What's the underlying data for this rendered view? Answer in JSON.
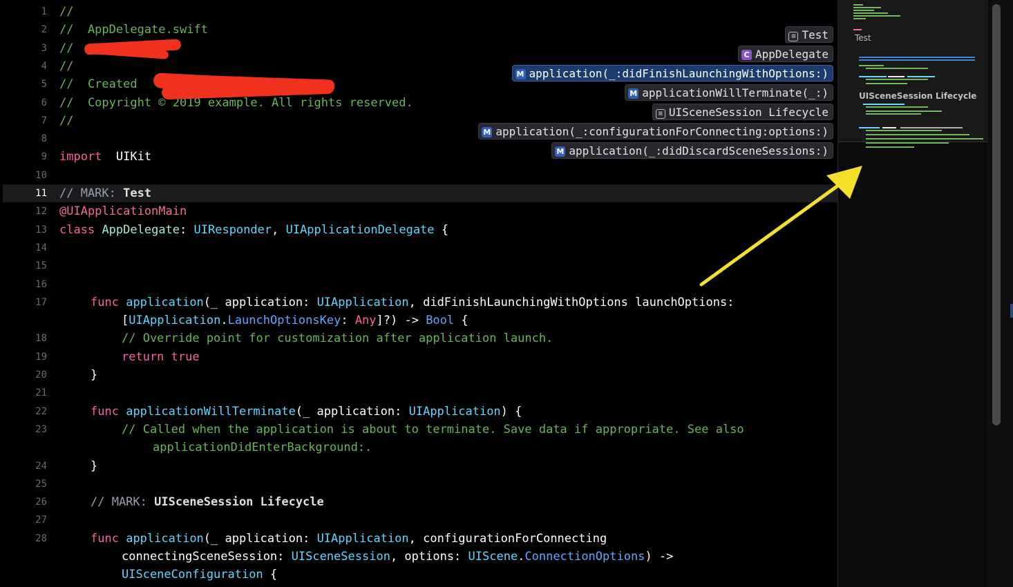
{
  "editor": {
    "lines": [
      {
        "n": "1",
        "ind": 0,
        "tokens": [
          [
            "cm",
            "//"
          ]
        ]
      },
      {
        "n": "2",
        "ind": 0,
        "tokens": [
          [
            "cm",
            "//  AppDelegate.swift"
          ]
        ]
      },
      {
        "n": "3",
        "ind": 0,
        "tokens": [
          [
            "cm",
            "//  "
          ]
        ]
      },
      {
        "n": "4",
        "ind": 0,
        "tokens": [
          [
            "cm",
            "//"
          ]
        ]
      },
      {
        "n": "5",
        "ind": 0,
        "tokens": [
          [
            "cm",
            "//  Created "
          ]
        ]
      },
      {
        "n": "6",
        "ind": 0,
        "tokens": [
          [
            "cm",
            "//  Copyright © 2019 example. All rights reserved."
          ]
        ]
      },
      {
        "n": "7",
        "ind": 0,
        "tokens": [
          [
            "cm",
            "//"
          ]
        ]
      },
      {
        "n": "8",
        "ind": 0,
        "tokens": []
      },
      {
        "n": "9",
        "ind": 0,
        "tokens": [
          [
            "kw",
            "import"
          ],
          [
            "",
            "  UIKit"
          ]
        ]
      },
      {
        "n": "10",
        "ind": 0,
        "tokens": []
      },
      {
        "n": "11",
        "ind": 0,
        "current": true,
        "tokens": [
          [
            "mark",
            "// MARK: "
          ],
          [
            "markb",
            "Test"
          ]
        ]
      },
      {
        "n": "12",
        "ind": 0,
        "tokens": [
          [
            "attr",
            "@UIApplicationMain"
          ]
        ]
      },
      {
        "n": "13",
        "ind": 0,
        "tokens": [
          [
            "kw",
            "class"
          ],
          [
            "",
            " "
          ],
          [
            "cls",
            "AppDelegate"
          ],
          [
            "",
            ": "
          ],
          [
            "ty",
            "UIResponder"
          ],
          [
            "",
            ", "
          ],
          [
            "ty",
            "UIApplicationDelegate"
          ],
          [
            "",
            " {"
          ]
        ]
      },
      {
        "n": "14",
        "ind": 0,
        "tokens": []
      },
      {
        "n": "15",
        "ind": 0,
        "tokens": []
      },
      {
        "n": "16",
        "ind": 0,
        "tokens": []
      },
      {
        "n": "17",
        "ind": 2,
        "tokens": [
          [
            "kw",
            "func"
          ],
          [
            "",
            " "
          ],
          [
            "ty",
            "application"
          ],
          [
            "",
            "(_ application: "
          ],
          [
            "ty",
            "UIApplication"
          ],
          [
            "",
            ", didFinishLaunchingWithOptions launchOptions:"
          ]
        ]
      },
      {
        "n": "",
        "ind": 4,
        "tokens": [
          [
            "",
            "["
          ],
          [
            "ty",
            "UIApplication"
          ],
          [
            "",
            "."
          ],
          [
            "tyb",
            "LaunchOptionsKey"
          ],
          [
            "",
            ": "
          ],
          [
            "kw",
            "Any"
          ],
          [
            "",
            "]?) -> "
          ],
          [
            "tyb",
            "Bool"
          ],
          [
            "",
            " {"
          ]
        ]
      },
      {
        "n": "18",
        "ind": 4,
        "tokens": [
          [
            "cm",
            "// Override point for customization after application launch."
          ]
        ]
      },
      {
        "n": "19",
        "ind": 4,
        "tokens": [
          [
            "kw",
            "return true"
          ]
        ]
      },
      {
        "n": "20",
        "ind": 2,
        "tokens": [
          [
            "",
            "}"
          ]
        ]
      },
      {
        "n": "21",
        "ind": 0,
        "tokens": []
      },
      {
        "n": "22",
        "ind": 2,
        "tokens": [
          [
            "kw",
            "func"
          ],
          [
            "",
            " "
          ],
          [
            "ty",
            "applicationWillTerminate"
          ],
          [
            "",
            "(_ application: "
          ],
          [
            "ty",
            "UIApplication"
          ],
          [
            "",
            ") {"
          ]
        ]
      },
      {
        "n": "23",
        "ind": 4,
        "tokens": [
          [
            "cm",
            "// Called when the application is about to terminate. Save data if appropriate. See also"
          ]
        ]
      },
      {
        "n": "",
        "ind": 6,
        "tokens": [
          [
            "cm",
            "applicationDidEnterBackground:."
          ]
        ]
      },
      {
        "n": "24",
        "ind": 2,
        "tokens": [
          [
            "",
            "}"
          ]
        ]
      },
      {
        "n": "25",
        "ind": 0,
        "tokens": []
      },
      {
        "n": "26",
        "ind": 2,
        "tokens": [
          [
            "mark",
            "// MARK: "
          ],
          [
            "markb",
            "UISceneSession Lifecycle"
          ]
        ]
      },
      {
        "n": "27",
        "ind": 0,
        "tokens": []
      },
      {
        "n": "28",
        "ind": 2,
        "tokens": [
          [
            "kw",
            "func"
          ],
          [
            "",
            " "
          ],
          [
            "ty",
            "application"
          ],
          [
            "",
            "(_ application: "
          ],
          [
            "ty",
            "UIApplication"
          ],
          [
            "",
            ", configurationForConnecting"
          ]
        ]
      },
      {
        "n": "",
        "ind": 4,
        "tokens": [
          [
            "",
            "connectingSceneSession: "
          ],
          [
            "ty",
            "UISceneSession"
          ],
          [
            "",
            ", options: "
          ],
          [
            "ty",
            "UIScene"
          ],
          [
            "",
            "."
          ],
          [
            "tyb",
            "ConnectionOptions"
          ],
          [
            "",
            ") ->"
          ]
        ]
      },
      {
        "n": "",
        "ind": 4,
        "tokens": [
          [
            "ty",
            "UISceneConfiguration"
          ],
          [
            "",
            " {"
          ]
        ]
      }
    ]
  },
  "jump_bar": [
    {
      "kind": "mark",
      "label": "Test",
      "selected": false
    },
    {
      "kind": "class",
      "label": "AppDelegate",
      "selected": false
    },
    {
      "kind": "method",
      "label": "application(_:didFinishLaunchingWithOptions:)",
      "selected": true
    },
    {
      "kind": "method",
      "label": "applicationWillTerminate(_:)",
      "selected": false
    },
    {
      "kind": "mark",
      "label": "UISceneSession Lifecycle",
      "selected": false
    },
    {
      "kind": "method",
      "label": "application(_:configurationForConnecting:options:)",
      "selected": false
    },
    {
      "kind": "method",
      "label": "application(_:didDiscardSceneSessions:)",
      "selected": false
    }
  ],
  "badges": {
    "method": "M",
    "class": "C",
    "mark": "≡"
  },
  "minimap": {
    "labels": [
      "Test",
      "UISceneSession Lifecycle"
    ]
  },
  "colors": {
    "background": "#000000",
    "comment": "#6cb458",
    "keyword": "#fc5fa3",
    "type": "#5dd8ff",
    "selection": "#1d3c6e",
    "annotation_arrow": "#f4e02a",
    "redaction": "#f0311d"
  }
}
